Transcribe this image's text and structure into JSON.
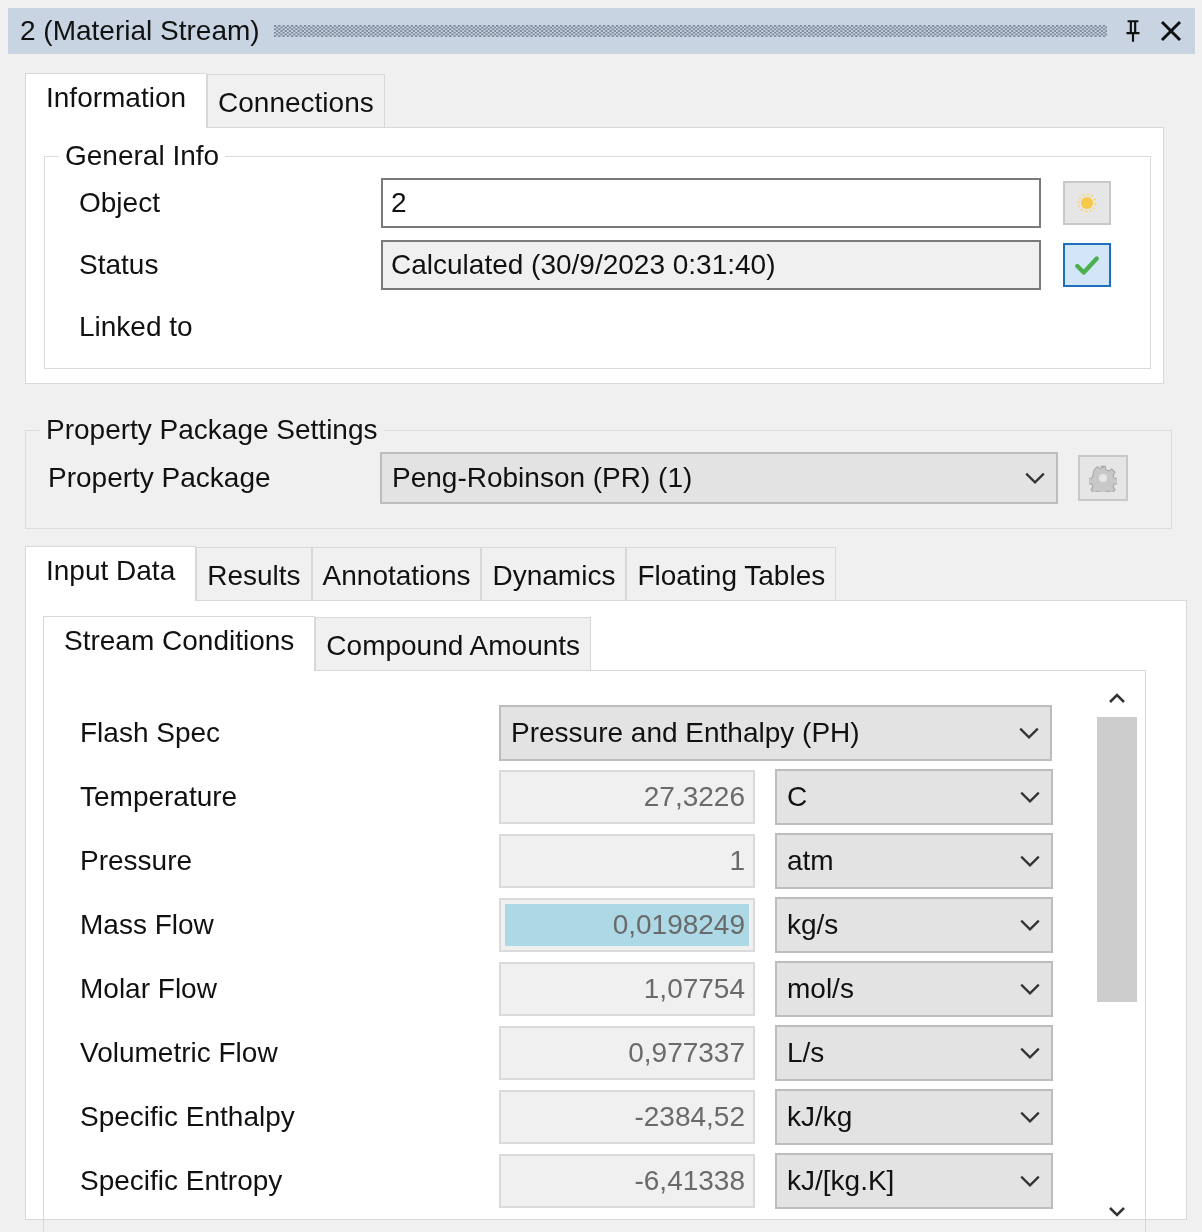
{
  "window": {
    "title": "2 (Material Stream)"
  },
  "tabs": [
    {
      "label": "Information",
      "selected": true
    },
    {
      "label": "Connections",
      "selected": false
    }
  ],
  "general_info": {
    "title": "General Info",
    "fields": [
      {
        "label": "Object",
        "value": "2",
        "kind": "edit"
      },
      {
        "label": "Status",
        "value": "Calculated (30/9/2023 0:31:40)",
        "kind": "status"
      },
      {
        "label": "Linked to",
        "kind": "label"
      }
    ]
  },
  "property_package_settings": {
    "title": "Property Package Settings",
    "label": "Property Package",
    "value": "Peng-Robinson (PR) (1)"
  },
  "data_tabs": [
    {
      "label": "Input Data",
      "selected": true
    },
    {
      "label": "Results",
      "selected": false
    },
    {
      "label": "Annotations",
      "selected": false
    },
    {
      "label": "Dynamics",
      "selected": false
    },
    {
      "label": "Floating Tables",
      "selected": false
    }
  ],
  "sub_tabs": [
    {
      "label": "Stream Conditions",
      "selected": true
    },
    {
      "label": "Compound Amounts",
      "selected": false
    }
  ],
  "stream_conditions": {
    "flash_spec": {
      "label": "Flash Spec",
      "value": "Pressure and Enthalpy (PH)"
    },
    "rows": [
      {
        "label": "Temperature",
        "value": "27,3226",
        "unit": "C",
        "highlighted": false
      },
      {
        "label": "Pressure",
        "value": "1",
        "unit": "atm",
        "highlighted": false
      },
      {
        "label": "Mass Flow",
        "value": "0,0198249",
        "unit": "kg/s",
        "highlighted": true
      },
      {
        "label": "Molar Flow",
        "value": "1,07754",
        "unit": "mol/s",
        "highlighted": false
      },
      {
        "label": "Volumetric Flow",
        "value": "0,977337",
        "unit": "L/s",
        "highlighted": false
      },
      {
        "label": "Specific Enthalpy",
        "value": "-2384,52",
        "unit": "kJ/kg",
        "highlighted": false
      },
      {
        "label": "Specific Entropy",
        "value": "-6,41338",
        "unit": "kJ/[kg.K]",
        "highlighted": false
      }
    ]
  }
}
